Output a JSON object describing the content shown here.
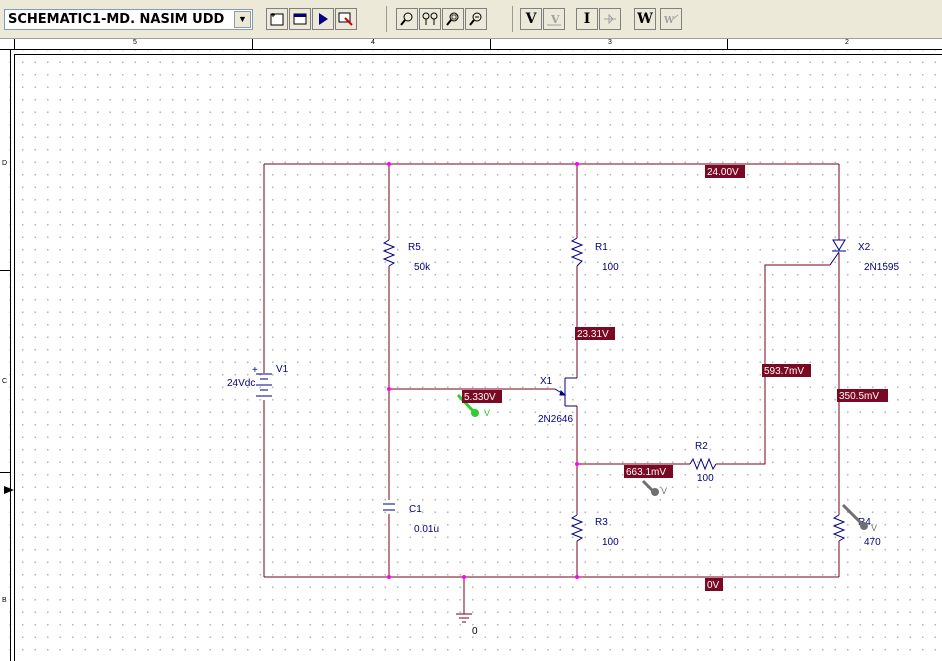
{
  "toolbar": {
    "design_name": "SCHEMATIC1-MD. NASIM UDD",
    "buttons": [
      {
        "name": "new-page-icon",
        "label": ""
      },
      {
        "name": "window-icon",
        "label": ""
      },
      {
        "name": "run-icon",
        "label": ""
      },
      {
        "name": "probe-icon",
        "label": ""
      },
      {
        "name": "zoom-in-icon",
        "label": ""
      },
      {
        "name": "zoom-fit-icon",
        "label": ""
      },
      {
        "name": "zoom-area-icon",
        "label": ""
      },
      {
        "name": "zoom-out-icon",
        "label": ""
      },
      {
        "name": "voltage-toggle",
        "label": "V"
      },
      {
        "name": "voltage-marker",
        "label": ""
      },
      {
        "name": "current-toggle",
        "label": "I"
      },
      {
        "name": "current-marker",
        "label": ""
      },
      {
        "name": "power-toggle",
        "label": "W"
      },
      {
        "name": "power-marker",
        "label": ""
      }
    ]
  },
  "ruler": {
    "columns": [
      "5",
      "4",
      "3",
      "2"
    ],
    "rows": [
      "D",
      "C",
      "B"
    ]
  },
  "components": {
    "v1": {
      "ref": "V1",
      "value": "24Vdc"
    },
    "r5": {
      "ref": "R5",
      "value": "50k"
    },
    "r1": {
      "ref": "R1",
      "value": "100"
    },
    "x1": {
      "ref": "X1",
      "value": "2N2646"
    },
    "x2": {
      "ref": "X2",
      "value": "2N1595"
    },
    "r2": {
      "ref": "R2",
      "value": "100"
    },
    "r3": {
      "ref": "R3",
      "value": "100"
    },
    "r4": {
      "ref": "R4",
      "value": "470"
    },
    "c1": {
      "ref": "C1",
      "value": "0.01u"
    },
    "gnd": {
      "ref": "0"
    }
  },
  "voltages": {
    "top": "24.00V",
    "r1_bottom": "23.31V",
    "emitter": "5.330V",
    "x2_gate": "593.7mV",
    "x2_cathode": "350.5mV",
    "b1": "663.1mV",
    "ground": "0V"
  },
  "markers": {
    "v_label": "V"
  },
  "colors": {
    "wire": "#7a0019",
    "bias_bg": "#7a0a23",
    "component": "#000080",
    "marker_green": "#33cc33",
    "marker_gray": "#707070"
  }
}
